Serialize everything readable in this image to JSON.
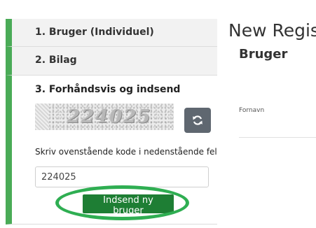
{
  "steps": [
    {
      "label": "1. Bruger (Individuel)"
    },
    {
      "label": "2. Bilag"
    },
    {
      "label": "3. Forhåndsvis og indsend"
    }
  ],
  "captcha": {
    "code": "224025",
    "refresh_icon": "refresh-icon"
  },
  "form": {
    "instruction": "Skriv ovenstående kode i nedenstående felt.",
    "code_value": "224025",
    "submit_label": "Indsend ny bruger"
  },
  "right_panel": {
    "heading": "New Regist",
    "subheading": "Bruger",
    "field_label": "Fornavn"
  },
  "colors": {
    "accent_green": "#4aab57",
    "button_green": "#1e7e34",
    "highlight_green": "#2fae52",
    "refresh_button": "#5f6770"
  }
}
